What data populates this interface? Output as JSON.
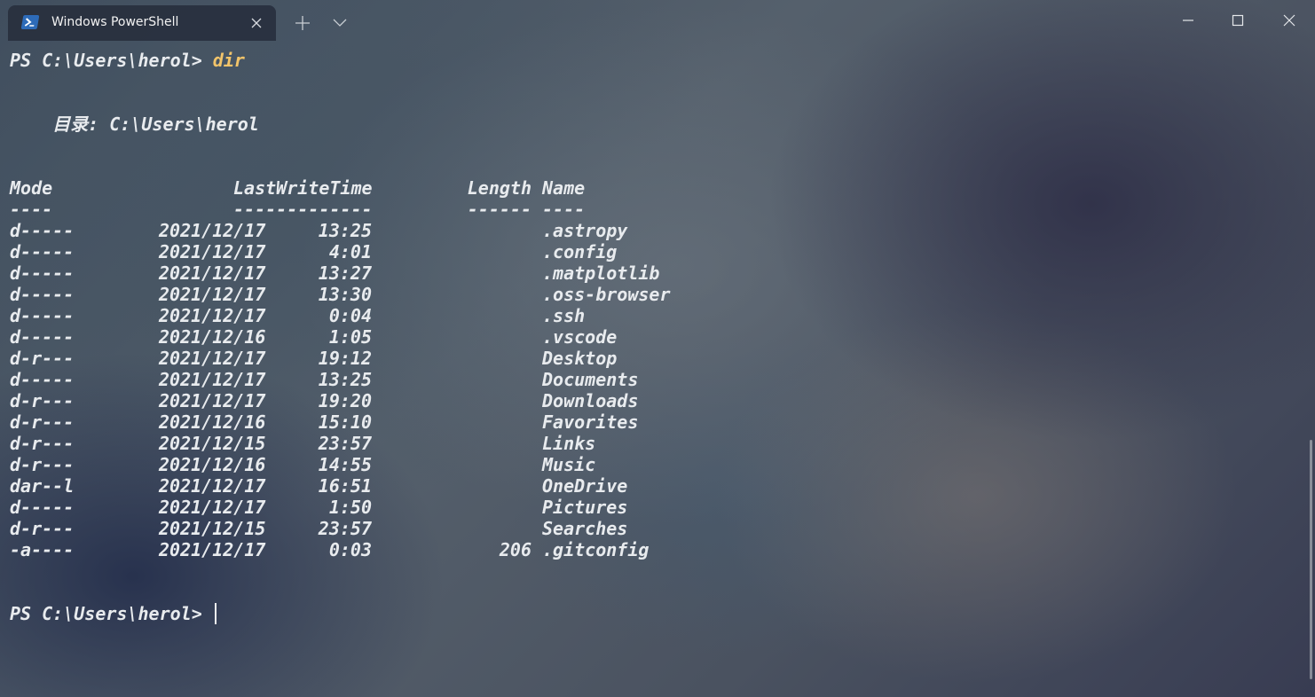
{
  "window": {
    "tab_title": "Windows PowerShell",
    "tab_icon": "powershell-icon",
    "new_tab_icon": "plus-icon",
    "dropdown_icon": "chevron-down-icon"
  },
  "terminal": {
    "prompt": "PS C:\\Users\\herol> ",
    "command": "dir",
    "directory_line": "    目录: C:\\Users\\herol",
    "headers": {
      "mode": "Mode",
      "lastwritetime": "LastWriteTime",
      "length": "Length",
      "name": "Name"
    },
    "separators": {
      "mode": "----",
      "lastwritetime": "-------------",
      "length": "------",
      "name": "----"
    },
    "rows": [
      {
        "mode": "d-----",
        "date": "2021/12/17",
        "time": "13:25",
        "length": "",
        "name": ".astropy"
      },
      {
        "mode": "d-----",
        "date": "2021/12/17",
        "time": "4:01",
        "length": "",
        "name": ".config"
      },
      {
        "mode": "d-----",
        "date": "2021/12/17",
        "time": "13:27",
        "length": "",
        "name": ".matplotlib"
      },
      {
        "mode": "d-----",
        "date": "2021/12/17",
        "time": "13:30",
        "length": "",
        "name": ".oss-browser"
      },
      {
        "mode": "d-----",
        "date": "2021/12/17",
        "time": "0:04",
        "length": "",
        "name": ".ssh"
      },
      {
        "mode": "d-----",
        "date": "2021/12/16",
        "time": "1:05",
        "length": "",
        "name": ".vscode"
      },
      {
        "mode": "d-r---",
        "date": "2021/12/17",
        "time": "19:12",
        "length": "",
        "name": "Desktop"
      },
      {
        "mode": "d-----",
        "date": "2021/12/17",
        "time": "13:25",
        "length": "",
        "name": "Documents"
      },
      {
        "mode": "d-r---",
        "date": "2021/12/17",
        "time": "19:20",
        "length": "",
        "name": "Downloads"
      },
      {
        "mode": "d-r---",
        "date": "2021/12/16",
        "time": "15:10",
        "length": "",
        "name": "Favorites"
      },
      {
        "mode": "d-r---",
        "date": "2021/12/15",
        "time": "23:57",
        "length": "",
        "name": "Links"
      },
      {
        "mode": "d-r---",
        "date": "2021/12/16",
        "time": "14:55",
        "length": "",
        "name": "Music"
      },
      {
        "mode": "dar--l",
        "date": "2021/12/17",
        "time": "16:51",
        "length": "",
        "name": "OneDrive"
      },
      {
        "mode": "d-----",
        "date": "2021/12/17",
        "time": "1:50",
        "length": "",
        "name": "Pictures"
      },
      {
        "mode": "d-r---",
        "date": "2021/12/15",
        "time": "23:57",
        "length": "",
        "name": "Searches"
      },
      {
        "mode": "-a----",
        "date": "2021/12/17",
        "time": "0:03",
        "length": "206",
        "name": ".gitconfig"
      }
    ],
    "colors": {
      "command": "#f2c46a",
      "text": "#e8ebee"
    }
  }
}
